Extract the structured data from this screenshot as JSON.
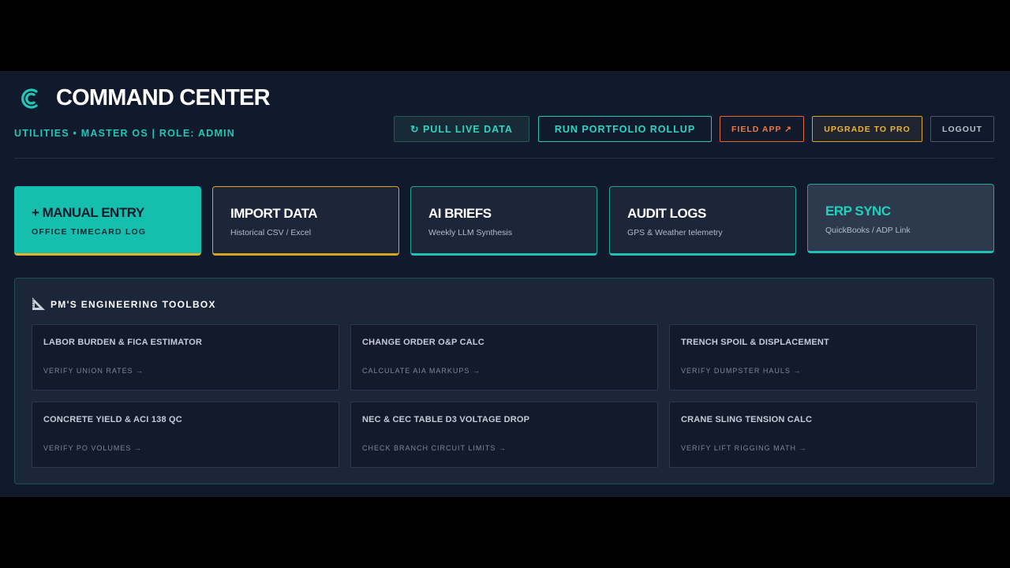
{
  "header": {
    "title": "COMMAND CENTER",
    "subtitle": "UTILITIES • MASTER OS | ROLE: ADMIN"
  },
  "toolbar": {
    "pull_label": "↻ PULL LIVE DATA",
    "rollup_label": "RUN PORTFOLIO ROLLUP",
    "field_label": "FIELD APP ↗",
    "upgrade_label": "UPGRADE TO PRO",
    "logout_label": "LOGOUT"
  },
  "cards": [
    {
      "title": "+ MANUAL ENTRY",
      "subtitle": "OFFICE TIMECARD LOG"
    },
    {
      "title": "IMPORT DATA",
      "subtitle": "Historical CSV / Excel"
    },
    {
      "title": "AI BRIEFS",
      "subtitle": "Weekly LLM Synthesis"
    },
    {
      "title": "AUDIT LOGS",
      "subtitle": "GPS & Weather telemetry"
    },
    {
      "title": "ERP SYNC",
      "subtitle": "QuickBooks / ADP Link"
    }
  ],
  "toolbox": {
    "title": "PM'S ENGINEERING TOOLBOX",
    "tools": [
      {
        "title": "LABOR BURDEN & FICA ESTIMATOR",
        "link": "VERIFY UNION RATES →"
      },
      {
        "title": "CHANGE ORDER O&P CALC",
        "link": "CALCULATE AIA MARKUPS →"
      },
      {
        "title": "TRENCH SPOIL & DISPLACEMENT",
        "link": "VERIFY DUMPSTER HAULS →"
      },
      {
        "title": "CONCRETE YIELD & ACI 138 QC",
        "link": "VERIFY PO VOLUMES →"
      },
      {
        "title": "NEC & CEC TABLE D3 VOLTAGE DROP",
        "link": "CHECK BRANCH CIRCUIT LIMITS →"
      },
      {
        "title": "CRANE SLING TENSION CALC",
        "link": "VERIFY LIFT RIGGING MATH →"
      }
    ]
  },
  "icons": {
    "logo": "c-logo-icon",
    "toolbox": "set-square-icon"
  },
  "colors": {
    "accent": "#14bfae",
    "warning": "#d8a323",
    "orange": "#e06a36",
    "background": "#111a2c"
  }
}
